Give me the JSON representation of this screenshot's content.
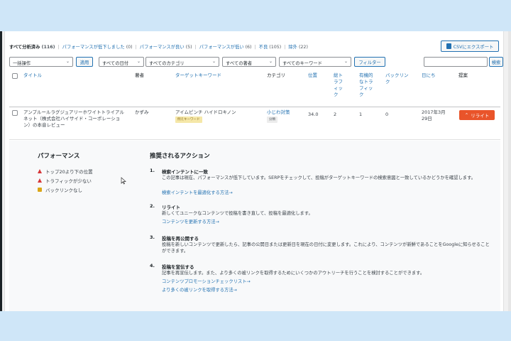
{
  "filters": {
    "items": [
      {
        "label": "すべて分析済み",
        "count": "(116)"
      },
      {
        "label": "パフォーマンスが低下しました",
        "count": "(0)"
      },
      {
        "label": "パフォーマンスが良い",
        "count": "(5)"
      },
      {
        "label": "パフォーマンスが低い",
        "count": "(6)"
      },
      {
        "label": "不良",
        "count": "(105)"
      },
      {
        "label": "除外",
        "count": "(22)"
      }
    ],
    "separator": "|"
  },
  "csv_button": "CSVにエクスポート",
  "controls": {
    "bulk_action": "一括操作",
    "apply": "適用",
    "date_filter": "すべての日付",
    "category_filter": "すべてのカテゴリ",
    "author_filter": "すべての著者",
    "keyword_filter": "すべてのキーワード",
    "filter_button": "フィルター",
    "search_value": "",
    "search_button": "検索"
  },
  "columns": {
    "title": "タイトル",
    "author": "著者",
    "keyword": "ターゲットキーワード",
    "category": "カテゴリ",
    "position": "位置",
    "total_traffic": "総ト\nラフ\nィッ\nク",
    "organic_traffic": "有機的\nなトラ\nフィッ\nク",
    "backlinks": "バックリン\nク",
    "date": "日にち",
    "suggestion": "提案"
  },
  "row": {
    "title": "アンプルールラグジュアリーホワイトトライアルネット（株式会社ハイサイド・コーポレーション）の本音レビュー",
    "author": "かずみ",
    "keyword": "アイムピンチ ハイドロキノン",
    "keyword_tag": "例えキーワード",
    "category": "小じわ対策",
    "category_tag": "分類",
    "position": "34.0",
    "total_traffic": "2",
    "organic_traffic": "1",
    "backlinks": "0",
    "date": "2017年3月\n29日",
    "suggestion_button": "リライト"
  },
  "performance": {
    "heading": "パフォーマンス",
    "issues": [
      {
        "label": "トップ20より下の位置",
        "level": "warning"
      },
      {
        "label": "トラフィックが少ない",
        "level": "warning"
      },
      {
        "label": "バックリンクなし",
        "level": "info"
      }
    ]
  },
  "actions": {
    "heading": "推奨されるアクション",
    "items": [
      {
        "num": "1.",
        "title": "検索インテントに一致",
        "desc": "この記事は現在、パフォーマンスが低下しています。SERPをチェックして、投稿がターゲットキーワードの検索意図と一致しているかどうかを確認します。",
        "links": [
          "検索インテントを最適化する方法→"
        ]
      },
      {
        "num": "2.",
        "title": "リライト",
        "desc": "新しくてユニークなコンテンツで投稿を書き直して、投稿を最適化します。",
        "links": [
          "コンテンツを更新する方法→"
        ]
      },
      {
        "num": "3.",
        "title": "投稿を再公開する",
        "desc": "投稿を新しいコンテンツで更新したら、記事の公開日または更新日を現在の日付に変更します。これにより、コンテンツが新鮮であることをGoogleに知らせることができます。",
        "links": []
      },
      {
        "num": "4.",
        "title": "投稿を宣伝する",
        "desc": "記事を再宣伝します。また、より多くの被リンクを取得するためにいくつかのアウトリーチを行うことを検討することができます。",
        "links": [
          "コンテンツプロモーションチェックリスト→",
          "より多くの被リンクを取得する方法→"
        ]
      }
    ]
  },
  "colors": {
    "link": "#2271b1",
    "rewrite": "#e9542a",
    "warning": "#d63638",
    "info": "#dba617",
    "background": "#cfe6f8"
  }
}
